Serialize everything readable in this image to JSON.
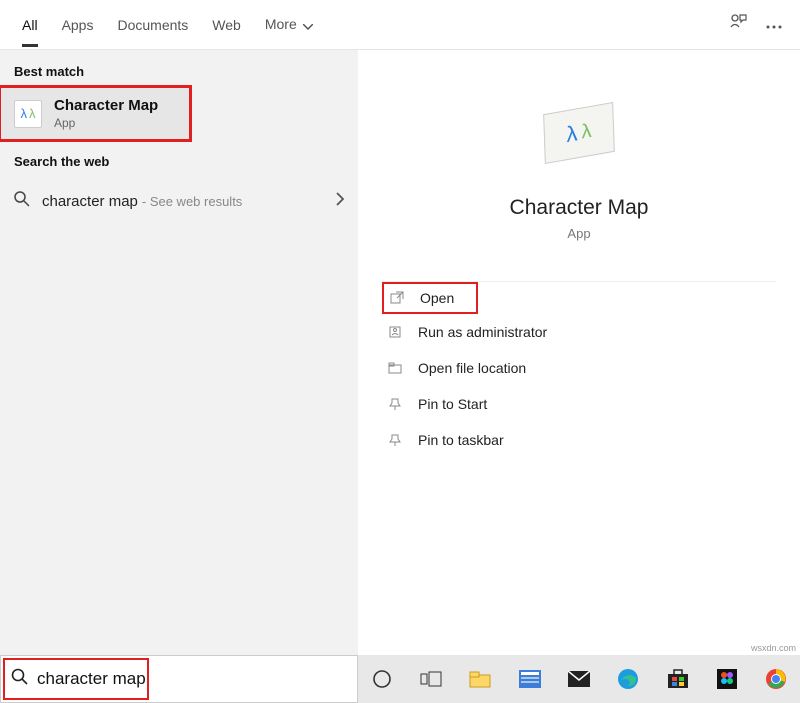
{
  "tabs": {
    "all": "All",
    "apps": "Apps",
    "documents": "Documents",
    "web": "Web",
    "more": "More"
  },
  "left": {
    "best_match_label": "Best match",
    "best_match": {
      "title": "Character Map",
      "subtitle": "App"
    },
    "search_web_label": "Search the web",
    "web_result": {
      "text": "character map",
      "suffix": " -  See web results"
    }
  },
  "preview": {
    "title": "Character Map",
    "subtitle": "App"
  },
  "actions": {
    "open": "Open",
    "run_admin": "Run as administrator",
    "open_loc": "Open file location",
    "pin_start": "Pin to Start",
    "pin_taskbar": "Pin to taskbar"
  },
  "search": {
    "value": "character map"
  },
  "watermark": "wsxdn.com"
}
